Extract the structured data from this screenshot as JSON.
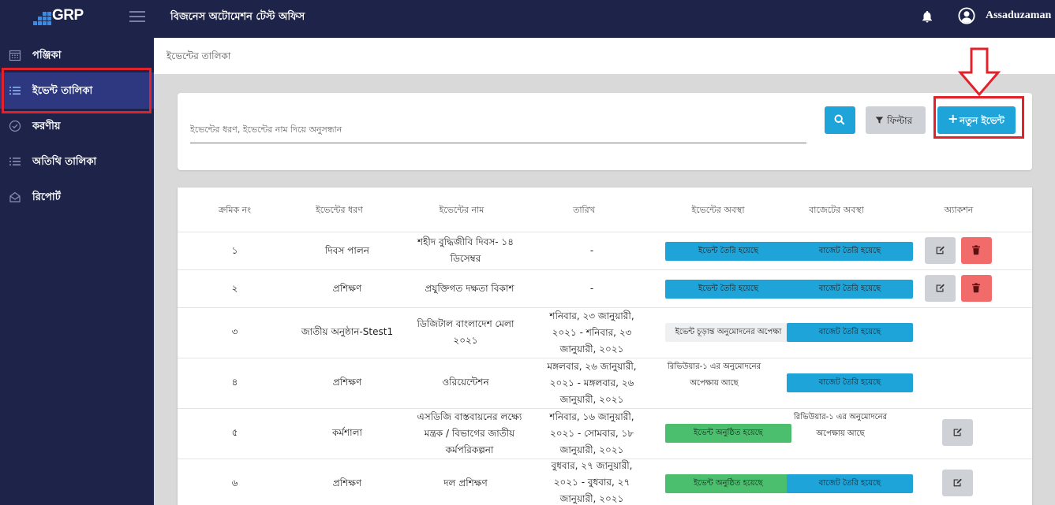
{
  "header": {
    "logo_text": "GRP",
    "office_title": "বিজনেস অটোমেশন টেস্ট অফিস",
    "user_name": "Assaduzaman"
  },
  "sidebar": {
    "items": [
      {
        "label": "পঞ্জিকা",
        "icon": "calendar-icon"
      },
      {
        "label": "ইভেন্ট তালিকা",
        "icon": "list-icon",
        "active": true
      },
      {
        "label": "করণীয়",
        "icon": "check-circle-icon"
      },
      {
        "label": "অতিথি তালিকা",
        "icon": "list-icon"
      },
      {
        "label": "রিপোর্ট",
        "icon": "report-icon"
      }
    ]
  },
  "breadcrumb": "ইভেন্টের তালিকা",
  "search": {
    "placeholder": "ইভেন্টের ধরণ, ইভেন্টের নাম দিয়ে অনুসন্ধান",
    "filter_label": "ফিল্টার",
    "new_event_label": "নতুন ইভেন্ট"
  },
  "table": {
    "headers": [
      "ক্রমিক নং",
      "ইভেন্টের ধরণ",
      "ইভেন্টের নাম",
      "তারিখ",
      "ইভেন্টের অবস্থা",
      "বাজেটের অবস্থা",
      "অ্যাকশন"
    ],
    "rows": [
      {
        "serial": "১",
        "type": "দিবস পালন",
        "name": "শহীদ বুদ্ধিজীবি দিবস- ১৪ ডিসেম্বর",
        "date": "-",
        "event_status": "ইভেন্ট তৈরি হয়েছে",
        "budget_status": "বাজেট তৈরি হয়েছে"
      },
      {
        "serial": "২",
        "type": "প্রশিক্ষণ",
        "name": "প্রযুক্তিগত দক্ষতা বিকাশ",
        "date": "-",
        "event_status": "ইভেন্ট তৈরি হয়েছে",
        "budget_status": "বাজেট তৈরি হয়েছে"
      },
      {
        "serial": "৩",
        "type": "জাতীয় অনুষ্ঠান-Stest1",
        "name": "ডিজিটাল বাংলাদেশ মেলা ২০২১",
        "date": "শনিবার, ২৩ জানুয়ারী, ২০২১ - শনিবার, ২৩ জানুয়ারী, ২০২১",
        "event_status": "ইভেন্ট চূড়ান্ত অনুমোদনের অপেক্ষা",
        "budget_status": "বাজেট তৈরি হয়েছে"
      },
      {
        "serial": "৪",
        "type": "প্রশিক্ষণ",
        "name": "ওরিয়েন্টেশন",
        "date": "মঙ্গলবার, ২৬ জানুয়ারী, ২০২১ - মঙ্গলবার, ২৬ জানুয়ারী, ২০২১",
        "event_status": "রিভিউয়ার-১ এর অনুমোদনের অপেক্ষায় আছে",
        "budget_status": "বাজেট তৈরি হয়েছে"
      },
      {
        "serial": "৫",
        "type": "কর্মশালা",
        "name": "এসডিজি বাস্তবায়নের লক্ষ্যে মন্ত্রক / বিভাগের জাতীয় কর্মপরিকল্পনা",
        "date": "শনিবার, ১৬ জানুয়ারী, ২০২১ - সোমবার, ১৮ জানুয়ারী, ২০২১",
        "event_status": "ইভেন্ট অনুষ্ঠিত হয়েছে",
        "budget_status": "রিভিউয়ার-১ এর অনুমোদনের অপেক্ষায় আছে"
      },
      {
        "serial": "৬",
        "type": "প্রশিক্ষণ",
        "name": "দল প্রশিক্ষণ",
        "date": "বুধবার, ২৭ জানুয়ারী, ২০২১ - বুধবার, ২৭ জানুয়ারী, ২০২১",
        "event_status": "ইভেন্ট অনুষ্ঠিত হয়েছে",
        "budget_status": "বাজেট তৈরি হয়েছে"
      }
    ]
  },
  "colors": {
    "nav_bg": "#1e2449",
    "accent_blue": "#1fa4d9",
    "success_green": "#4cbf6e",
    "danger_red": "#f26b6b",
    "highlight_red": "#e3212b"
  }
}
